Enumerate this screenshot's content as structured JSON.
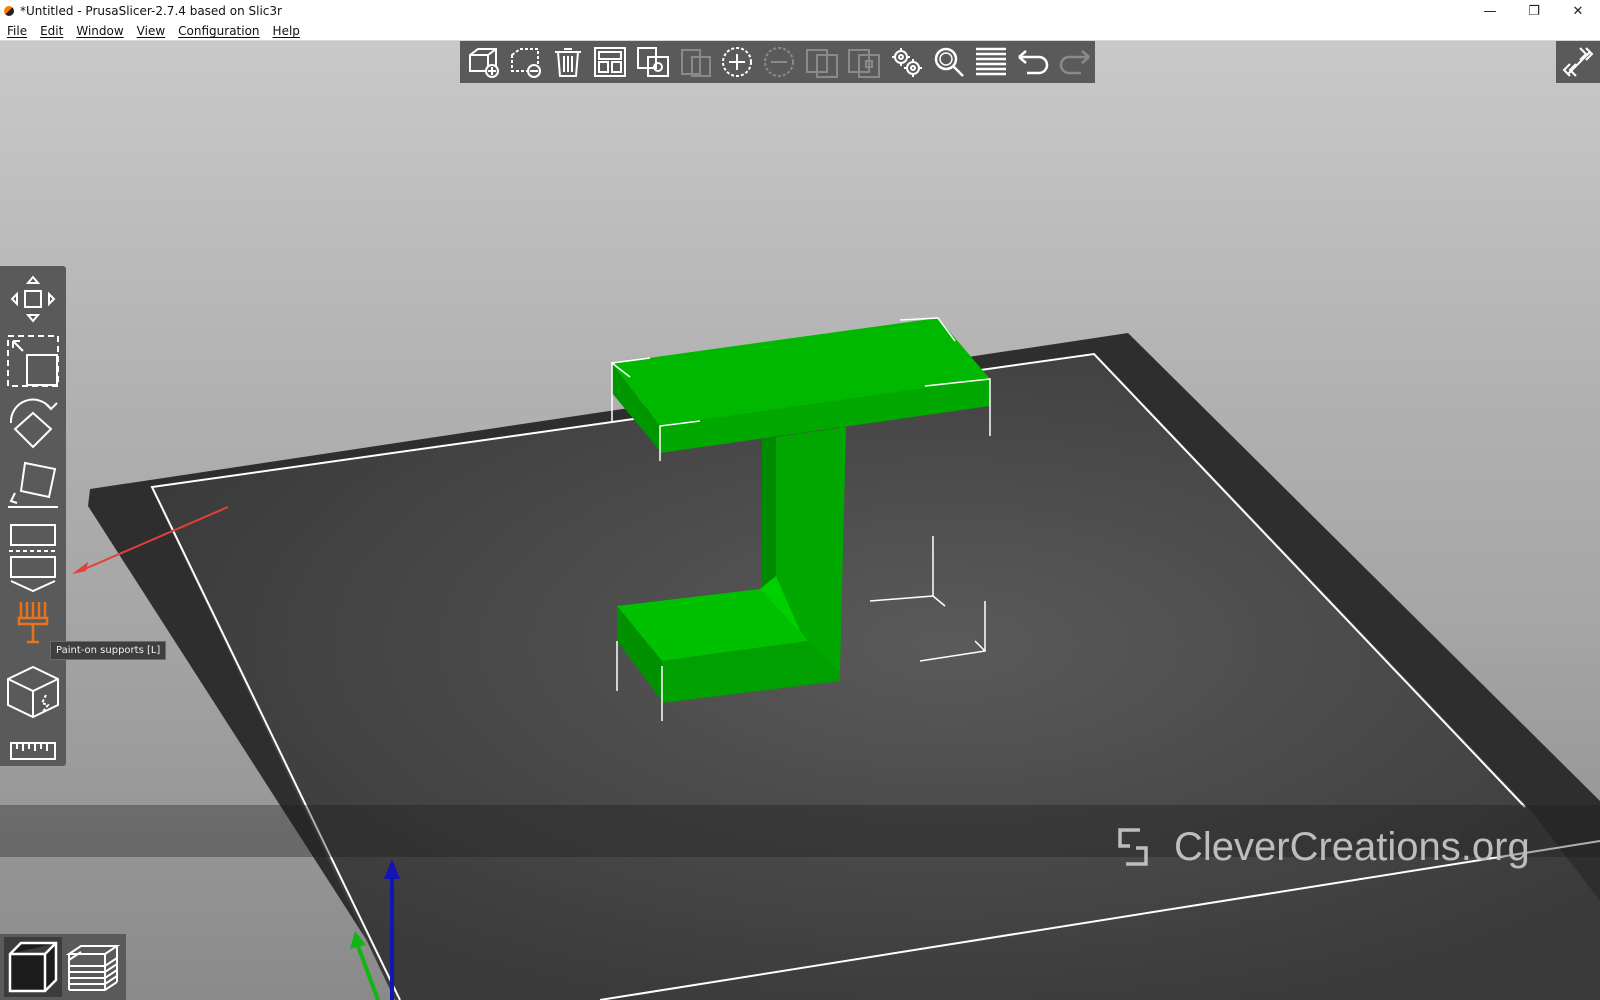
{
  "window": {
    "title": "*Untitled - PrusaSlicer-2.7.4 based on Slic3r",
    "controls": {
      "minimize": "—",
      "restore": "❐",
      "close": "✕"
    }
  },
  "menu": {
    "items": [
      "File",
      "Edit",
      "Window",
      "View",
      "Configuration",
      "Help"
    ]
  },
  "top_toolbar": {
    "buttons": [
      {
        "name": "add-icon",
        "enabled": true
      },
      {
        "name": "delete-icon",
        "enabled": true
      },
      {
        "name": "delete-all-icon",
        "enabled": true
      },
      {
        "name": "arrange-icon",
        "enabled": true
      },
      {
        "name": "copy-icon",
        "enabled": true
      },
      {
        "name": "paste-icon",
        "enabled": false
      },
      {
        "name": "add-instance-icon",
        "enabled": true
      },
      {
        "name": "remove-instance-icon",
        "enabled": false
      },
      {
        "name": "split-objects-icon",
        "enabled": false
      },
      {
        "name": "split-parts-icon",
        "enabled": false
      },
      {
        "name": "variable-layer-height-icon",
        "enabled": true
      },
      {
        "name": "search-icon",
        "enabled": true
      },
      {
        "name": "layers-editing-icon",
        "enabled": true
      },
      {
        "name": "undo-icon",
        "enabled": true
      },
      {
        "name": "redo-icon",
        "enabled": false
      }
    ]
  },
  "left_toolbar": {
    "tools": [
      "move-icon",
      "scale-icon",
      "rotate-icon",
      "place-on-face-icon",
      "cut-icon",
      "paint-on-supports-icon",
      "seam-painting-icon",
      "measure-icon"
    ],
    "active_tool": "paint-on-supports-icon",
    "tooltip": "Paint-on supports [L]"
  },
  "bottom_views": [
    "3d-view-icon",
    "preview-icon"
  ],
  "watermark": {
    "text": "CleverCreations.org"
  },
  "colors": {
    "model": "#00b400",
    "toolbar": "#5a5a5a",
    "bed": "#3a3a3a",
    "active_tool": "#e8731e",
    "annotation_arrow": "#e0423a"
  }
}
